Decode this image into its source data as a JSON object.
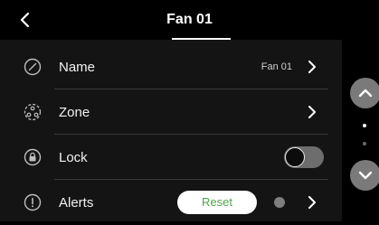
{
  "header": {
    "title": "Fan 01"
  },
  "rows": [
    {
      "label": "Name",
      "value": "Fan 01"
    },
    {
      "label": "Zone"
    },
    {
      "label": "Lock",
      "toggle_on": false
    },
    {
      "label": "Alerts",
      "reset_label": "Reset"
    }
  ],
  "pagination": {
    "current_page": 1,
    "total_pages": 2
  },
  "colors": {
    "background": "#000000",
    "panel": "#141414",
    "reset_text": "#55a14c",
    "toggle_track": "#6d6d6d",
    "scroll_button": "#7a7a7a"
  },
  "icons": {
    "back": "chevron-left-icon",
    "name": "edit-circle-icon",
    "zone": "zone-icon",
    "lock": "lock-icon",
    "alerts": "alert-icon",
    "row_chevron": "chevron-right-icon",
    "scroll_up": "chevron-up-icon",
    "scroll_down": "chevron-down-icon"
  }
}
